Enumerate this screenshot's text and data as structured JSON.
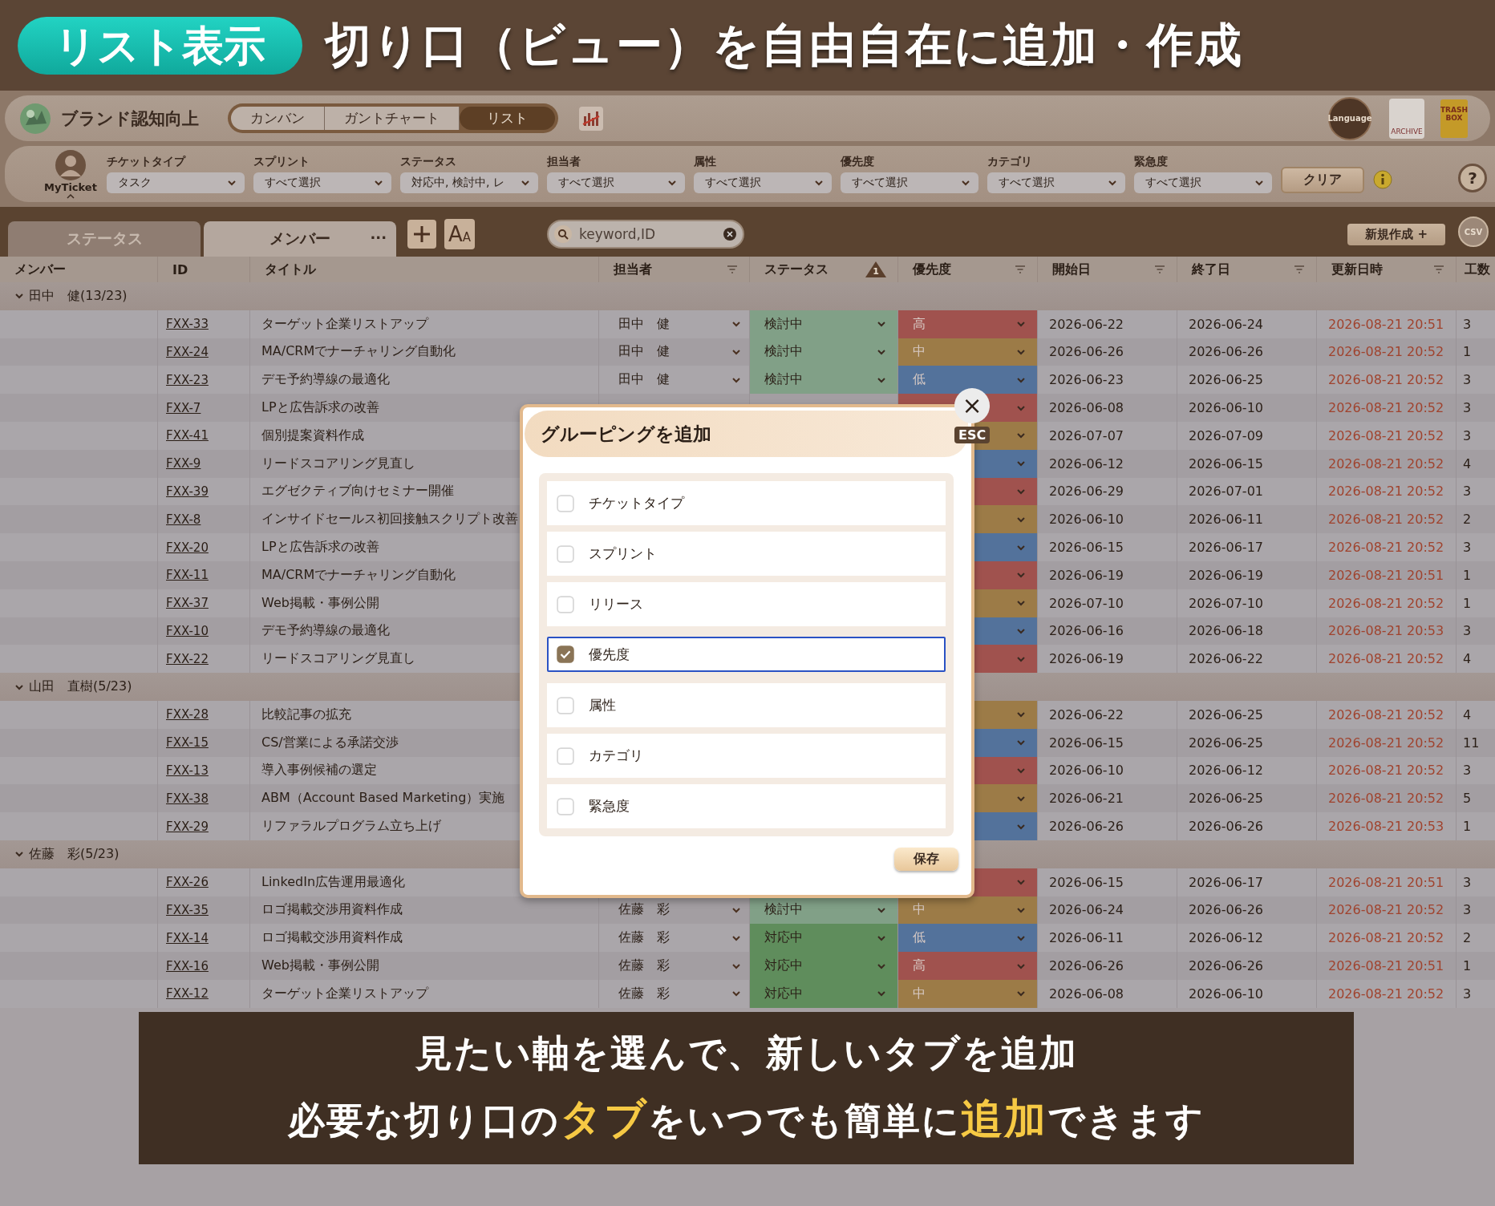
{
  "banner": {
    "pill": "リスト表示",
    "headline": "切り口（ビュー）を自由自在に追加・作成"
  },
  "project": {
    "name": "ブランド認知向上"
  },
  "views": [
    {
      "label": "カンバン",
      "selected": false
    },
    {
      "label": "ガントチャート",
      "selected": false
    },
    {
      "label": "リスト",
      "selected": true
    }
  ],
  "header_icons": {
    "language": "Language",
    "archive": "ARCHIVE",
    "trash": [
      "TRASH",
      "BOX"
    ]
  },
  "user": {
    "name": "MyTicket"
  },
  "filters": [
    {
      "label": "チケットタイプ",
      "value": "タスク"
    },
    {
      "label": "スプリント",
      "value": "すべて選択"
    },
    {
      "label": "ステータス",
      "value": "対応中, 検討中, レ"
    },
    {
      "label": "担当者",
      "value": "すべて選択"
    },
    {
      "label": "属性",
      "value": "すべて選択"
    },
    {
      "label": "優先度",
      "value": "すべて選択"
    },
    {
      "label": "カテゴリ",
      "value": "すべて選択"
    },
    {
      "label": "緊急度",
      "value": "すべて選択"
    }
  ],
  "clear_button": "クリア",
  "help": "?",
  "tabs": [
    {
      "label": "ステータス",
      "selected": false
    },
    {
      "label": "メンバー",
      "selected": true,
      "more": "···"
    }
  ],
  "font_button": [
    "A",
    "A"
  ],
  "search": {
    "placeholder": "keyword,ID"
  },
  "new_button": "新規作成 +",
  "csv_label": "CSV",
  "columns": [
    {
      "label": "メンバー",
      "filter": false
    },
    {
      "label": "ID",
      "filter": false
    },
    {
      "label": "タイトル",
      "filter": false
    },
    {
      "label": "担当者",
      "filter": true
    },
    {
      "label": "ステータス",
      "filter": false,
      "badge": "1"
    },
    {
      "label": "優先度",
      "filter": true
    },
    {
      "label": "開始日",
      "filter": true
    },
    {
      "label": "終了日",
      "filter": true
    },
    {
      "label": "更新日時",
      "filter": true
    },
    {
      "label": "工数",
      "filter": false
    }
  ],
  "groups": [
    {
      "name": "田中　健(13/23)",
      "expanded": true,
      "rows": [
        {
          "id": "FXX-33",
          "title": "ターゲット企業リストアップ",
          "assignee": "田中　健",
          "status": {
            "label": "検討中",
            "color": "#81a087"
          },
          "priority": {
            "label": "高",
            "color": "#a0524e"
          },
          "start": "2026-06-22",
          "end": "2026-06-24",
          "updated": "2026-08-21 20:51",
          "effort": "3"
        },
        {
          "id": "FXX-24",
          "title": "MA/CRMでナーチャリング自動化",
          "assignee": "田中　健",
          "status": {
            "label": "検討中",
            "color": "#81a087"
          },
          "priority": {
            "label": "中",
            "color": "#9c7b47"
          },
          "start": "2026-06-26",
          "end": "2026-06-26",
          "updated": "2026-08-21 20:52",
          "effort": "1"
        },
        {
          "id": "FXX-23",
          "title": "デモ予約導線の最適化",
          "assignee": "田中　健",
          "status": {
            "label": "検討中",
            "color": "#81a087"
          },
          "priority": {
            "label": "低",
            "color": "#53729b"
          },
          "start": "2026-06-23",
          "end": "2026-06-25",
          "updated": "2026-08-21 20:52",
          "effort": "3"
        },
        {
          "id": "FXX-7",
          "title": "LPと広告訴求の改善",
          "priority": {
            "color": "#a0524e"
          },
          "start": "2026-06-08",
          "end": "2026-06-10",
          "updated": "2026-08-21 20:52",
          "effort": "3"
        },
        {
          "id": "FXX-41",
          "title": "個別提案資料作成",
          "priority": {
            "color": "#9c7b47"
          },
          "start": "2026-07-07",
          "end": "2026-07-09",
          "updated": "2026-08-21 20:52",
          "effort": "3"
        },
        {
          "id": "FXX-9",
          "title": "リードスコアリング見直し",
          "priority": {
            "color": "#53729b"
          },
          "start": "2026-06-12",
          "end": "2026-06-15",
          "updated": "2026-08-21 20:52",
          "effort": "4"
        },
        {
          "id": "FXX-39",
          "title": "エグゼクティブ向けセミナー開催",
          "priority": {
            "color": "#a0524e"
          },
          "start": "2026-06-29",
          "end": "2026-07-01",
          "updated": "2026-08-21 20:52",
          "effort": "3"
        },
        {
          "id": "FXX-8",
          "title": "インサイドセールス初回接触スクリプト改善",
          "priority": {
            "color": "#9c7b47"
          },
          "start": "2026-06-10",
          "end": "2026-06-11",
          "updated": "2026-08-21 20:52",
          "effort": "2"
        },
        {
          "id": "FXX-20",
          "title": "LPと広告訴求の改善",
          "priority": {
            "color": "#53729b"
          },
          "start": "2026-06-15",
          "end": "2026-06-17",
          "updated": "2026-08-21 20:52",
          "effort": "3"
        },
        {
          "id": "FXX-11",
          "title": "MA/CRMでナーチャリング自動化",
          "priority": {
            "color": "#a0524e"
          },
          "start": "2026-06-19",
          "end": "2026-06-19",
          "updated": "2026-08-21 20:51",
          "effort": "1"
        },
        {
          "id": "FXX-37",
          "title": "Web掲載・事例公開",
          "priority": {
            "color": "#9c7b47"
          },
          "start": "2026-07-10",
          "end": "2026-07-10",
          "updated": "2026-08-21 20:52",
          "effort": "1"
        },
        {
          "id": "FXX-10",
          "title": "デモ予約導線の最適化",
          "priority": {
            "color": "#53729b"
          },
          "start": "2026-06-16",
          "end": "2026-06-18",
          "updated": "2026-08-21 20:53",
          "effort": "3"
        },
        {
          "id": "FXX-22",
          "title": "リードスコアリング見直し",
          "priority": {
            "color": "#a0524e"
          },
          "start": "2026-06-19",
          "end": "2026-06-22",
          "updated": "2026-08-21 20:52",
          "effort": "4"
        }
      ]
    },
    {
      "name": "山田　直樹(5/23)",
      "expanded": true,
      "rows": [
        {
          "id": "FXX-28",
          "title": "比較記事の拡充",
          "priority": {
            "color": "#9c7b47"
          },
          "start": "2026-06-22",
          "end": "2026-06-25",
          "updated": "2026-08-21 20:52",
          "effort": "4"
        },
        {
          "id": "FXX-15",
          "title": "CS/営業による承諾交渉",
          "priority": {
            "color": "#53729b"
          },
          "start": "2026-06-15",
          "end": "2026-06-25",
          "updated": "2026-08-21 20:52",
          "effort": "11"
        },
        {
          "id": "FXX-13",
          "title": "導入事例候補の選定",
          "priority": {
            "color": "#a0524e"
          },
          "start": "2026-06-10",
          "end": "2026-06-12",
          "updated": "2026-08-21 20:52",
          "effort": "3"
        },
        {
          "id": "FXX-38",
          "title": "ABM（Account Based Marketing）実施",
          "priority": {
            "color": "#9c7b47"
          },
          "start": "2026-06-21",
          "end": "2026-06-25",
          "updated": "2026-08-21 20:52",
          "effort": "5"
        },
        {
          "id": "FXX-29",
          "title": "リファラルプログラム立ち上げ",
          "priority": {
            "color": "#53729b"
          },
          "start": "2026-06-26",
          "end": "2026-06-26",
          "updated": "2026-08-21 20:53",
          "effort": "1"
        }
      ]
    },
    {
      "name": "佐藤　彩(5/23)",
      "expanded": true,
      "rows": [
        {
          "id": "FXX-26",
          "title": "LinkedIn広告運用最適化",
          "priority": {
            "color": "#a0524e"
          },
          "start": "2026-06-15",
          "end": "2026-06-17",
          "updated": "2026-08-21 20:51",
          "effort": "3"
        },
        {
          "id": "FXX-35",
          "title": "ロゴ掲載交渉用資料作成",
          "assignee": "佐藤　彩",
          "status": {
            "label": "検討中",
            "color": "#81a087"
          },
          "priority": {
            "label": "中",
            "color": "#9c7b47"
          },
          "start": "2026-06-24",
          "end": "2026-06-26",
          "updated": "2026-08-21 20:52",
          "effort": "3"
        },
        {
          "id": "FXX-14",
          "title": "ロゴ掲載交渉用資料作成",
          "assignee": "佐藤　彩",
          "status": {
            "label": "対応中",
            "color": "#5f8d5c"
          },
          "priority": {
            "label": "低",
            "color": "#53729b"
          },
          "start": "2026-06-11",
          "end": "2026-06-12",
          "updated": "2026-08-21 20:52",
          "effort": "2"
        },
        {
          "id": "FXX-16",
          "title": "Web掲載・事例公開",
          "assignee": "佐藤　彩",
          "status": {
            "label": "対応中",
            "color": "#5f8d5c"
          },
          "priority": {
            "label": "高",
            "color": "#a0524e"
          },
          "start": "2026-06-26",
          "end": "2026-06-26",
          "updated": "2026-08-21 20:51",
          "effort": "1"
        },
        {
          "id": "FXX-12",
          "title": "ターゲット企業リストアップ",
          "assignee": "佐藤　彩",
          "status": {
            "label": "対応中",
            "color": "#5f8d5c"
          },
          "priority": {
            "label": "中",
            "color": "#9c7b47"
          },
          "start": "2026-06-08",
          "end": "2026-06-10",
          "updated": "2026-08-21 20:52",
          "effort": "3"
        }
      ]
    }
  ],
  "modal": {
    "title": "グルーピングを追加",
    "close": "×",
    "esc": "ESC",
    "options": [
      {
        "label": "チケットタイプ",
        "checked": false,
        "selected": false
      },
      {
        "label": "スプリント",
        "checked": false,
        "selected": false
      },
      {
        "label": "リリース",
        "checked": false,
        "selected": false
      },
      {
        "label": "優先度",
        "checked": true,
        "selected": true
      },
      {
        "label": "属性",
        "checked": false,
        "selected": false
      },
      {
        "label": "カテゴリ",
        "checked": false,
        "selected": false
      },
      {
        "label": "緊急度",
        "checked": false,
        "selected": false
      }
    ],
    "save": "保存"
  },
  "caption": {
    "lines": [
      "見たい軸を選んで、新しいタブを追加",
      "必要な切り口の**タブ**をいつでも簡単に**追加**できます"
    ]
  }
}
